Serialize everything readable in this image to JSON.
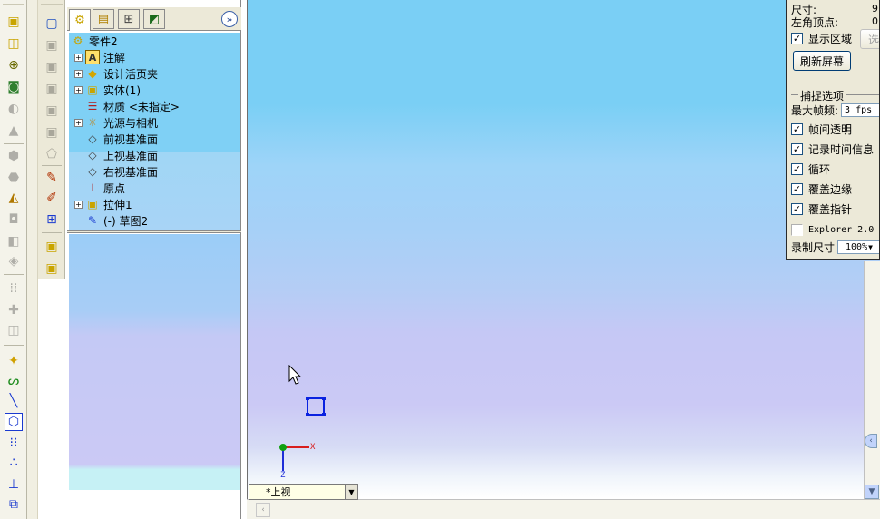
{
  "colors": {
    "viewport_top": "#7acff5",
    "viewport_bottom": "#cbc9f5",
    "tree_bg": "#7fd0f5",
    "sketch_blue": "#0a22e0",
    "axis_x": "#d81e1e",
    "axis_z": "#1e2ed8",
    "origin": "#10a010",
    "dialog_bg": "#ece9d8"
  },
  "toolbar_left": {
    "icons": [
      "extrude-boss-icon",
      "revolve-icon",
      "sweep-icon",
      "loft-icon",
      "rib-icon",
      "shell-icon",
      "fillet-icon",
      "chamfer-icon",
      "draft-icon",
      "dome-icon",
      "wrap-icon",
      "pattern-icon",
      "mirror-icon",
      "reference-geometry-icon",
      "curves-icon",
      "line-icon",
      "polygon-icon",
      "grid-icon",
      "points-icon",
      "origin-icon",
      "spline-icon"
    ]
  },
  "toolbar_sketch": {
    "icons": [
      "box-icon",
      "extrude-disabled-icon",
      "cut-disabled-icon",
      "hole-disabled-icon",
      "feature-disabled-icon",
      "shell-disabled-icon",
      "surface-disabled-icon",
      "edit-sketch-icon",
      "smart-dimension-icon",
      "relations-icon",
      "part-icon",
      "assembly-icon"
    ]
  },
  "feature_manager": {
    "tabs": [
      "feature-tree-tab",
      "property-tab",
      "configuration-tab",
      "display-tab"
    ],
    "tree": [
      {
        "label": "零件2",
        "icon": "part-icon",
        "expand": false,
        "indent": 0
      },
      {
        "label": "注解",
        "icon": "annotation-icon",
        "expand": true,
        "indent": 1
      },
      {
        "label": "设计活页夹",
        "icon": "design-binder-icon",
        "expand": true,
        "indent": 1
      },
      {
        "label": "实体(1)",
        "icon": "solid-bodies-icon",
        "expand": true,
        "indent": 1
      },
      {
        "label": "材质 <未指定>",
        "icon": "material-icon",
        "expand": false,
        "indent": 1
      },
      {
        "label": "光源与相机",
        "icon": "lights-icon",
        "expand": true,
        "indent": 1
      },
      {
        "label": "前视基准面",
        "icon": "plane-icon",
        "expand": false,
        "indent": 1
      },
      {
        "label": "上视基准面",
        "icon": "plane-icon",
        "expand": false,
        "indent": 1
      },
      {
        "label": "右视基准面",
        "icon": "plane-icon",
        "expand": false,
        "indent": 1
      },
      {
        "label": "原点",
        "icon": "origin-icon",
        "expand": false,
        "indent": 1
      },
      {
        "label": "拉伸1",
        "icon": "extrude-feature-icon",
        "expand": true,
        "indent": 1
      },
      {
        "label": "(-) 草图2",
        "icon": "sketch-icon",
        "expand": false,
        "indent": 1
      }
    ]
  },
  "viewport": {
    "view_name": "*上视",
    "axis_x_label": "X",
    "axis_z_label": "Z"
  },
  "capture_dialog": {
    "size_label": "尺寸:",
    "size_value": "9",
    "corner_label": "左角顶点:",
    "corner_value": "0",
    "show_region": "显示区域",
    "select_button": "选",
    "refresh_button": "刷新屏幕",
    "capture_group": "捕捉选项",
    "max_fps_label": "最大帧频:",
    "max_fps_value": "3 fps",
    "options": [
      {
        "label": "帧间透明",
        "checked": true
      },
      {
        "label": "记录时间信息",
        "checked": true
      },
      {
        "label": "循环",
        "checked": true
      },
      {
        "label": "覆盖边缘",
        "checked": true
      },
      {
        "label": "覆盖指针",
        "checked": true
      },
      {
        "label": "Explorer 2.0",
        "checked": false
      }
    ],
    "record_size_label": "录制尺寸",
    "record_size_value": "100%"
  }
}
